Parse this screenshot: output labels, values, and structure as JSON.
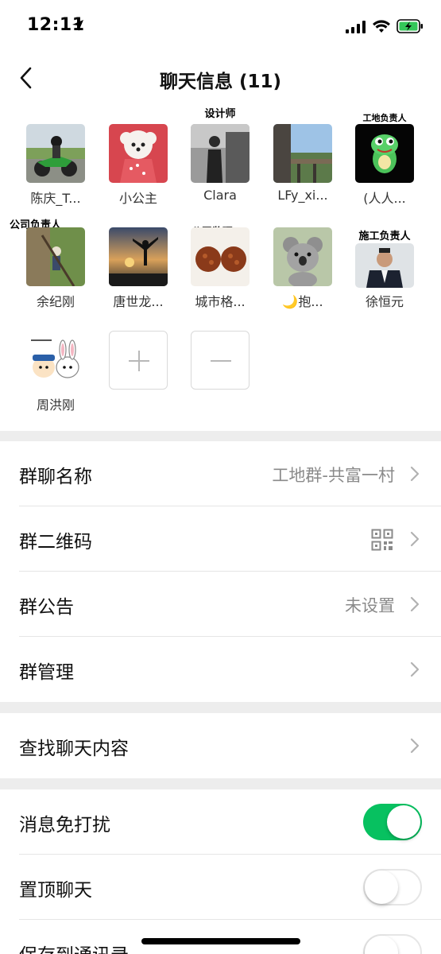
{
  "status_bar": {
    "time": "12:11",
    "icons": [
      "location-arrow-icon",
      "signal-icon",
      "wifi-icon",
      "battery-charging-icon"
    ]
  },
  "nav": {
    "title": "聊天信息 (11)",
    "back_icon": "chevron-left-icon"
  },
  "members": [
    {
      "name": "陈庆_T...",
      "tag": ""
    },
    {
      "name": "小公主",
      "tag": ""
    },
    {
      "name": "Clara",
      "tag": "设计师"
    },
    {
      "name": "LFy_xi...",
      "tag": ""
    },
    {
      "name": "(人人...",
      "tag": "工地负责人"
    },
    {
      "name": "余纪刚",
      "tag": "公司负责人"
    },
    {
      "name": "唐世龙...",
      "tag": ""
    },
    {
      "name": "城市格...",
      "tag": "公司监理"
    },
    {
      "name": "🌙抱...",
      "tag": ""
    },
    {
      "name": "徐恒元",
      "tag": "施工负责人"
    },
    {
      "name": "周洪刚",
      "tag": ""
    }
  ],
  "member_actions": {
    "add_icon": "plus-icon",
    "remove_icon": "minus-icon"
  },
  "settings": {
    "group_name_label": "群聊名称",
    "group_name_value": "工地群-共富一村",
    "qr_label": "群二维码",
    "notice_label": "群公告",
    "notice_value": "未设置",
    "manage_label": "群管理",
    "search_label": "查找聊天内容",
    "mute_label": "消息免打扰",
    "mute_on": true,
    "pin_label": "置顶聊天",
    "pin_on": false,
    "save_label": "保存到通讯录",
    "save_on": false
  },
  "colors": {
    "accent_green": "#07c160",
    "separator": "#ededed",
    "secondary_text": "#8a8a8a"
  }
}
